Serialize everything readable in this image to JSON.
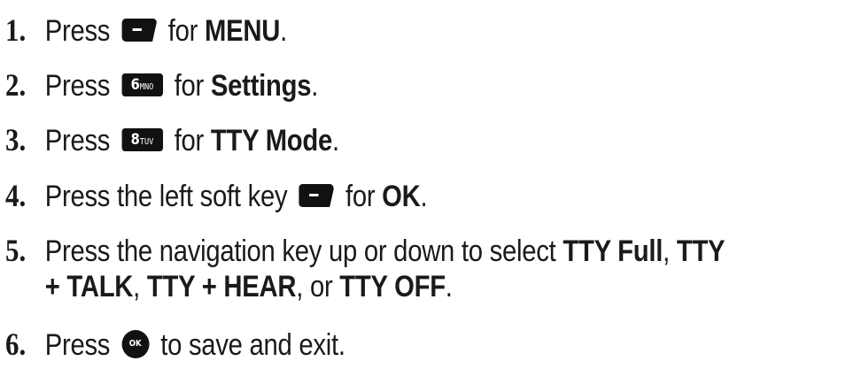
{
  "steps": [
    {
      "num": "1.",
      "pre": "Press",
      "key_icon": "left-soft-key-icon",
      "mid": "for",
      "bold": "MENU",
      "end": "."
    },
    {
      "num": "2.",
      "pre": "Press",
      "key_icon": "key-6-mno-icon",
      "key_digit": "6",
      "key_letters": "MNO",
      "mid": "for",
      "bold": "Settings",
      "end": "."
    },
    {
      "num": "3.",
      "pre": "Press",
      "key_icon": "key-8-tuv-icon",
      "key_digit": "8",
      "key_letters": "TUV",
      "mid": "for",
      "bold": "TTY Mode",
      "end": "."
    },
    {
      "num": "4.",
      "pre": "Press the left soft key",
      "key_icon": "left-soft-key-icon",
      "mid": "for",
      "bold": "OK",
      "end": "."
    },
    {
      "num": "5.",
      "line1_pre": "Press the navigation key up or down to select",
      "opt1": "TTY Full",
      "sep1": ",",
      "opt2_line1": "TTY",
      "opt2_line2": "+ TALK",
      "sep2": ",",
      "opt3": "TTY + HEAR",
      "sep3": ", or",
      "opt4": "TTY OFF",
      "end": "."
    },
    {
      "num": "6.",
      "pre": "Press",
      "key_icon": "ok-key-icon",
      "key_label": "OK",
      "post": "to save and exit."
    }
  ]
}
